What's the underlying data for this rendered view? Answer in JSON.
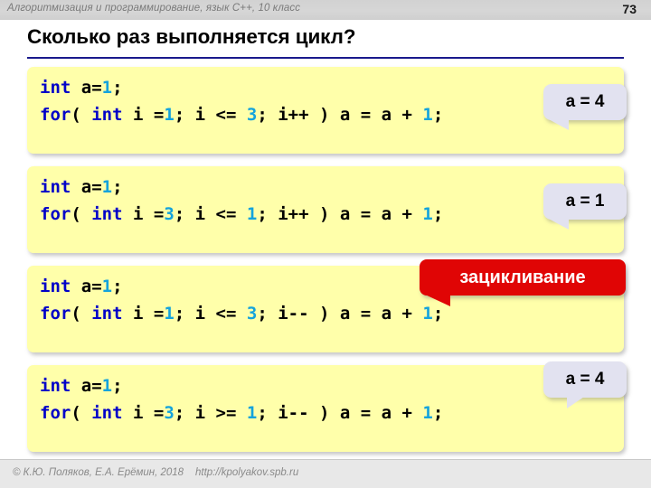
{
  "header": {
    "course_title": "Алгоритмизация и программирование, язык  C++, 10 класс",
    "page_number": "73"
  },
  "slide": {
    "title": "Сколько раз выполняется цикл?",
    "rule_color": "#1a1a8c"
  },
  "code_blocks": [
    {
      "id": "block-1",
      "background": "#ffffaa",
      "line1": {
        "kw_int": "int",
        "text_a": " a",
        "op_eq": "=",
        "num_1": "1",
        "semicolon": ";"
      },
      "line2": {
        "kw_for": "for",
        "paren_open": "( ",
        "kw_int": "int",
        "var_i": " i ",
        "op_eq": "=",
        "init_val": "1",
        "sep1": "; i ",
        "cond_op": "<=",
        "cond_val": "3",
        "sep2": "; i",
        "step": "++",
        "paren_close": " ) ",
        "body": "a = a + ",
        "body_val": "1",
        "semicolon": ";"
      },
      "full_text": "int a=1;  for( int i =1; i <= 3; i++ ) a = a + 1;"
    },
    {
      "id": "block-2",
      "background": "#ffffaa",
      "line1": {
        "kw_int": "int",
        "text_a": " a",
        "op_eq": "=",
        "num_1": "1",
        "semicolon": ";"
      },
      "line2": {
        "kw_for": "for",
        "paren_open": "( ",
        "kw_int": "int",
        "var_i": " i ",
        "op_eq": "=",
        "init_val": "3",
        "sep1": "; i ",
        "cond_op": "<=",
        "cond_val": "1",
        "sep2": "; i",
        "step": "++",
        "paren_close": " ) ",
        "body": "a = a + ",
        "body_val": "1",
        "semicolon": ";"
      },
      "full_text": "int a=1;  for( int i =3; i <= 1; i++ ) a = a + 1;"
    },
    {
      "id": "block-3",
      "background": "#ffffaa",
      "line1": {
        "kw_int": "int",
        "text_a": " a",
        "op_eq": "=",
        "num_1": "1",
        "semicolon": ";"
      },
      "line2": {
        "kw_for": "for",
        "paren_open": "( ",
        "kw_int": "int",
        "var_i": " i ",
        "op_eq": "=",
        "init_val": "1",
        "sep1": "; i ",
        "cond_op": "<=",
        "cond_val": "3",
        "sep2": "; i",
        "step": "--",
        "paren_close": " ) ",
        "body": "a = a + ",
        "body_val": "1",
        "semicolon": ";"
      },
      "full_text": "int a=1;  for( int i =1; i <= 3; i-- ) a = a + 1;"
    },
    {
      "id": "block-4",
      "background": "#ffffaa",
      "line1": {
        "kw_int": "int",
        "text_a": " a",
        "op_eq": "=",
        "num_1": "1",
        "semicolon": ";"
      },
      "line2": {
        "kw_for": "for",
        "paren_open": "( ",
        "kw_int": "int",
        "var_i": " i ",
        "op_eq": "=",
        "init_val": "3",
        "sep1": "; i ",
        "cond_op": ">=",
        "cond_val": "1",
        "sep2": "; i",
        "step": "--",
        "paren_close": " ) ",
        "body": "a = a + ",
        "body_val": "1",
        "semicolon": ";"
      },
      "full_text": "int a=1;  for( int i =3; i >= 1; i-- ) a = a + 1;"
    }
  ],
  "answers": {
    "answer_1": "a = 4",
    "answer_2": "a = 1",
    "answer_4": "a = 4",
    "callout_color": "#e2e2f0"
  },
  "badge": {
    "loop_warning": "зацикливание",
    "color": "#e00505",
    "text_color": "#ffffff"
  },
  "footer": {
    "copyright": "© К.Ю. Поляков, Е.А. Ерёмин, 2018",
    "url": "http://kpolyakov.spb.ru"
  },
  "colors": {
    "keyword": "#0000c8",
    "number": "#14a3dc",
    "code_bg": "#ffffaa",
    "header_bg": "#d4d4d4",
    "footer_bg": "#e8e8e8"
  }
}
